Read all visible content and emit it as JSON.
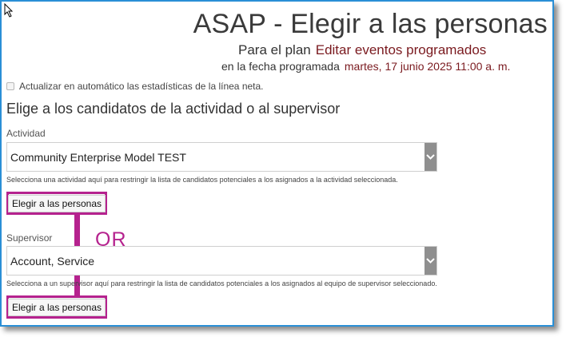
{
  "header": {
    "title": "ASAP - Elegir a las personas",
    "plan_prefix": "Para el plan",
    "plan_name": "Editar eventos programados",
    "date_prefix": "en la fecha programada",
    "date_value": "martes, 17 junio 2025 11:00 a. m."
  },
  "options": {
    "auto_update_label": "Actualizar en automático las estadísticas de la línea neta.",
    "auto_update_checked": false
  },
  "section": {
    "heading": "Elige a los candidatos de la actividad o al supervisor"
  },
  "activity": {
    "label": "Actividad",
    "selected": "Community Enterprise Model TEST",
    "hint": "Selecciona una actividad aquí para restringir la lista de candidatos potenciales a los asignados a la actividad seleccionada.",
    "button_label": "Elegir a las personas"
  },
  "annotation": {
    "or_text": "OR",
    "color": "#b5228e"
  },
  "supervisor": {
    "label": "Supervisor",
    "selected": "Account, Service",
    "hint": "Selecciona a un supervisor aquí para restringir la lista de candidatos potenciales a los asignados al equipo de supervisor seleccionado.",
    "button_label": "Elegir a las personas"
  },
  "colors": {
    "frame_border": "#2a8fd6",
    "accent_text": "#7a1a1f",
    "highlight": "#b5228e"
  }
}
